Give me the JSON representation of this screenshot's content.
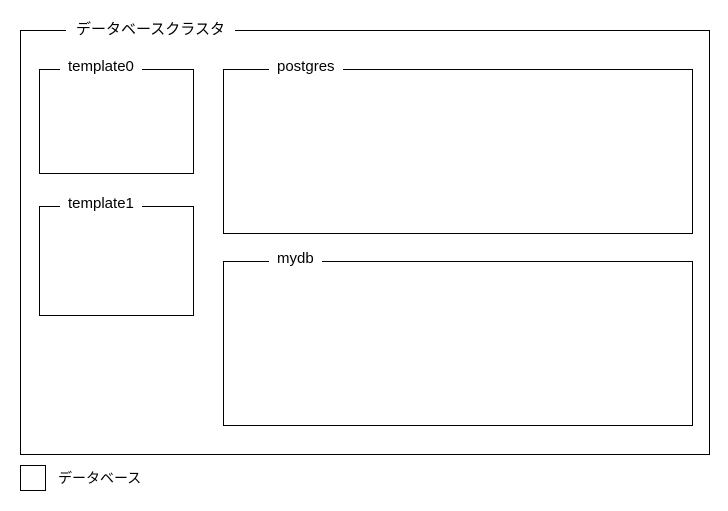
{
  "cluster": {
    "title": "データベースクラスタ"
  },
  "databases": {
    "template0": {
      "label": "template0"
    },
    "template1": {
      "label": "template1"
    },
    "postgres": {
      "label": "postgres"
    },
    "mydb": {
      "label": "mydb"
    }
  },
  "legend": {
    "label": "データベース"
  }
}
